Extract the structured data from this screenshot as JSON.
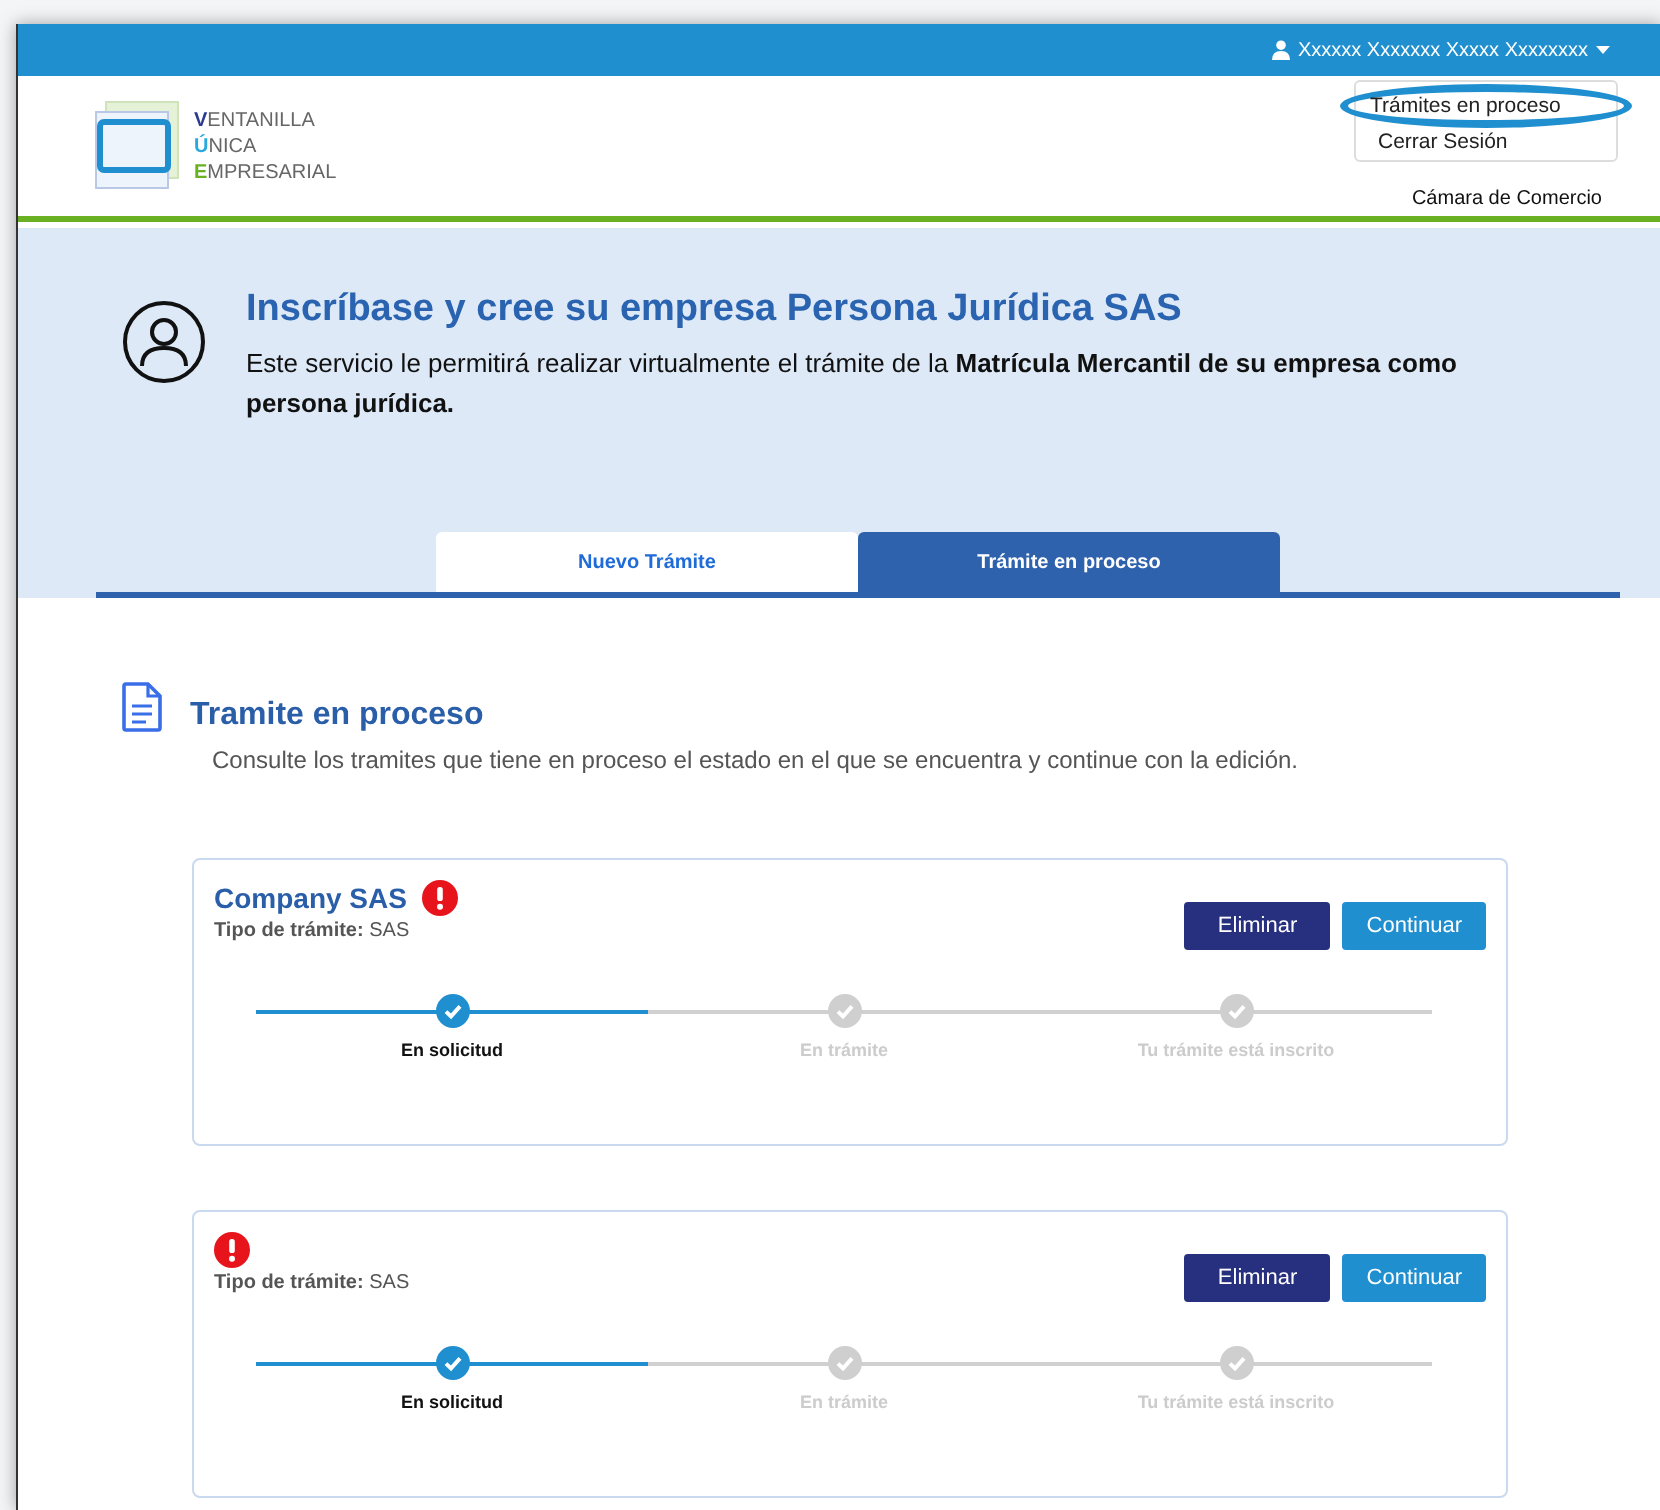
{
  "top_bar": {
    "user_name": "Xxxxxx Xxxxxxx Xxxxx Xxxxxxxx"
  },
  "user_menu": {
    "items": [
      {
        "label": "Trámites en proceso",
        "highlighted": true
      },
      {
        "label": "Cerrar Sesión",
        "highlighted": false
      }
    ]
  },
  "header": {
    "logo_lines": [
      {
        "text": "VENTANILLA",
        "color": "#2b3990"
      },
      {
        "text": "ÚNICA",
        "color": "#29a8e0"
      },
      {
        "text": "EMPRESARIAL",
        "color": "#6ab023"
      }
    ],
    "chamber": "Cámara de Comercio"
  },
  "banner": {
    "title": "Inscríbase y cree su empresa Persona Jurídica SAS",
    "description": "Este servicio le permitirá realizar virtualmente el trámite de la **Matrícula Mercantil de su empresa como persona jurídica.**"
  },
  "tabs": [
    {
      "label": "Nuevo Trámite",
      "selected": false
    },
    {
      "label": "Trámite en proceso",
      "selected": true
    }
  ],
  "section": {
    "title": "Tramite en proceso",
    "subtitle": "Consulte los tramites que tiene en proceso el estado en el que se encuentra y continue con la edición."
  },
  "procedures": [
    {
      "name": "Company SAS",
      "alert": true,
      "type": "**Tipo de trámite:** SAS",
      "buttons": [
        {
          "label": "Eliminar",
          "kind": "danger"
        },
        {
          "label": "Continuar",
          "kind": "primary"
        }
      ],
      "steps": [
        {
          "label": "En solicitud",
          "done": true
        },
        {
          "label": "En trámite",
          "done": false
        },
        {
          "label": "Tu trámite está inscrito",
          "done": false
        }
      ]
    },
    {
      "alert": true,
      "type": "**Tipo de trámite:** SAS",
      "buttons": [
        {
          "label": "Eliminar",
          "kind": "danger"
        },
        {
          "label": "Continuar",
          "kind": "primary"
        }
      ],
      "steps": [
        {
          "label": "En solicitud",
          "done": true
        },
        {
          "label": "En trámite",
          "done": false
        },
        {
          "label": "Tu trámite está inscrito",
          "done": false
        }
      ]
    }
  ]
}
